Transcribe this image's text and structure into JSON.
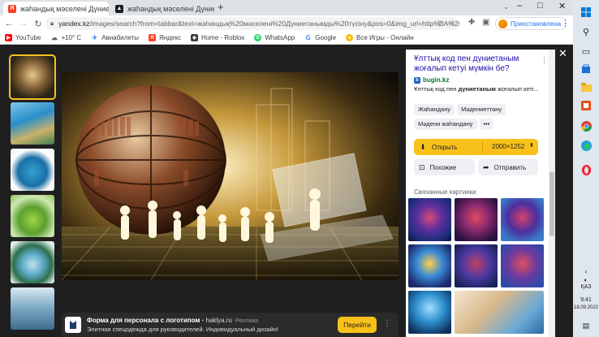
{
  "tabs": [
    {
      "title": "жаһандық мәселені Дүниетаны",
      "active": true
    },
    {
      "title": "жаһандық мәселені Дүниетаны",
      "active": false
    }
  ],
  "new_tab_label": "+",
  "window_controls": {
    "minimize": "–",
    "maximize": "□",
    "close": "✕"
  },
  "address_bar": {
    "domain": "yandex.kz",
    "path": "/images/search?from=tabbar&text=жаһандық%20мәселені%20Дүниетанымды%20түсіну&pos=0&img_url=http%3A%2F%..."
  },
  "profile": {
    "label": "Приостановлена"
  },
  "bookmarks": [
    {
      "label": "YouTube",
      "color": "#ff0000"
    },
    {
      "label": "+10° C",
      "color": "#5f6368"
    },
    {
      "label": "Авиабилеты",
      "color": "#4285f4"
    },
    {
      "label": "Яндекс",
      "color": "#fc3f1d"
    },
    {
      "label": "Home - Roblox",
      "color": "#3c4043"
    },
    {
      "label": "WhatsApp",
      "color": "#25d366"
    },
    {
      "label": "Google",
      "color": "#4285f4"
    },
    {
      "label": "Все Игры - Онлайн",
      "color": "#fbbc04"
    }
  ],
  "ad": {
    "title": "Форма для персонала с логотипом",
    "domain": "haklya.ru",
    "tag": "Реклама",
    "text": "Элитная спецодежда для руководителей. Индивидуальный дизайн!",
    "button": "Перейти"
  },
  "panel": {
    "title_part1": "Ұлттық код пен дүниетаным жоғалып кетуі мүмкін бе?",
    "source": "bugin.kz",
    "snippet_pre": "Ұлттық код пен ",
    "snippet_bold": "дүниетаным",
    "snippet_post": " жоғалып кеті...",
    "tags": [
      "Жаһандану",
      "Мәдениеттану",
      "Мәдени жаһандану"
    ],
    "tags_more": "•••",
    "open_label": "Открыть",
    "open_size": "2000×1252",
    "similar_label": "Похожие",
    "send_label": "Отправить",
    "related_label": "Связанные картинки"
  },
  "taskbar": {
    "lang": "ҚАЗ",
    "time": "9:41",
    "date": "18.09.2022"
  }
}
